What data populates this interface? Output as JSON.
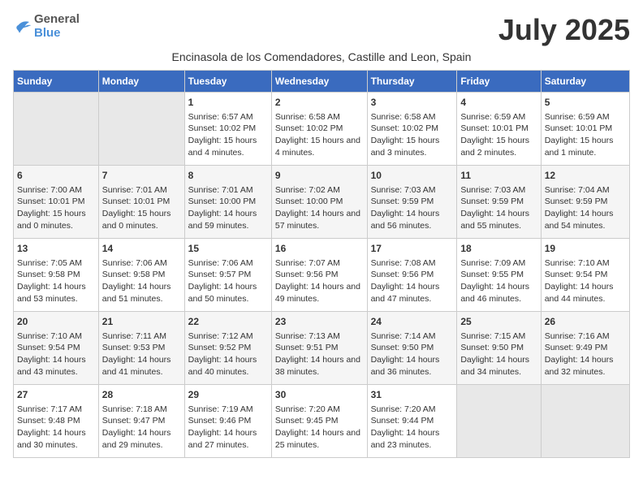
{
  "header": {
    "logo_general": "General",
    "logo_blue": "Blue",
    "month_title": "July 2025"
  },
  "subtitle": "Encinasola de los Comendadores, Castille and Leon, Spain",
  "days_of_week": [
    "Sunday",
    "Monday",
    "Tuesday",
    "Wednesday",
    "Thursday",
    "Friday",
    "Saturday"
  ],
  "weeks": [
    [
      {
        "day": "",
        "content": ""
      },
      {
        "day": "",
        "content": ""
      },
      {
        "day": "1",
        "content": "Sunrise: 6:57 AM\nSunset: 10:02 PM\nDaylight: 15 hours and 4 minutes."
      },
      {
        "day": "2",
        "content": "Sunrise: 6:58 AM\nSunset: 10:02 PM\nDaylight: 15 hours and 4 minutes."
      },
      {
        "day": "3",
        "content": "Sunrise: 6:58 AM\nSunset: 10:02 PM\nDaylight: 15 hours and 3 minutes."
      },
      {
        "day": "4",
        "content": "Sunrise: 6:59 AM\nSunset: 10:01 PM\nDaylight: 15 hours and 2 minutes."
      },
      {
        "day": "5",
        "content": "Sunrise: 6:59 AM\nSunset: 10:01 PM\nDaylight: 15 hours and 1 minute."
      }
    ],
    [
      {
        "day": "6",
        "content": "Sunrise: 7:00 AM\nSunset: 10:01 PM\nDaylight: 15 hours and 0 minutes."
      },
      {
        "day": "7",
        "content": "Sunrise: 7:01 AM\nSunset: 10:01 PM\nDaylight: 15 hours and 0 minutes."
      },
      {
        "day": "8",
        "content": "Sunrise: 7:01 AM\nSunset: 10:00 PM\nDaylight: 14 hours and 59 minutes."
      },
      {
        "day": "9",
        "content": "Sunrise: 7:02 AM\nSunset: 10:00 PM\nDaylight: 14 hours and 57 minutes."
      },
      {
        "day": "10",
        "content": "Sunrise: 7:03 AM\nSunset: 9:59 PM\nDaylight: 14 hours and 56 minutes."
      },
      {
        "day": "11",
        "content": "Sunrise: 7:03 AM\nSunset: 9:59 PM\nDaylight: 14 hours and 55 minutes."
      },
      {
        "day": "12",
        "content": "Sunrise: 7:04 AM\nSunset: 9:59 PM\nDaylight: 14 hours and 54 minutes."
      }
    ],
    [
      {
        "day": "13",
        "content": "Sunrise: 7:05 AM\nSunset: 9:58 PM\nDaylight: 14 hours and 53 minutes."
      },
      {
        "day": "14",
        "content": "Sunrise: 7:06 AM\nSunset: 9:58 PM\nDaylight: 14 hours and 51 minutes."
      },
      {
        "day": "15",
        "content": "Sunrise: 7:06 AM\nSunset: 9:57 PM\nDaylight: 14 hours and 50 minutes."
      },
      {
        "day": "16",
        "content": "Sunrise: 7:07 AM\nSunset: 9:56 PM\nDaylight: 14 hours and 49 minutes."
      },
      {
        "day": "17",
        "content": "Sunrise: 7:08 AM\nSunset: 9:56 PM\nDaylight: 14 hours and 47 minutes."
      },
      {
        "day": "18",
        "content": "Sunrise: 7:09 AM\nSunset: 9:55 PM\nDaylight: 14 hours and 46 minutes."
      },
      {
        "day": "19",
        "content": "Sunrise: 7:10 AM\nSunset: 9:54 PM\nDaylight: 14 hours and 44 minutes."
      }
    ],
    [
      {
        "day": "20",
        "content": "Sunrise: 7:10 AM\nSunset: 9:54 PM\nDaylight: 14 hours and 43 minutes."
      },
      {
        "day": "21",
        "content": "Sunrise: 7:11 AM\nSunset: 9:53 PM\nDaylight: 14 hours and 41 minutes."
      },
      {
        "day": "22",
        "content": "Sunrise: 7:12 AM\nSunset: 9:52 PM\nDaylight: 14 hours and 40 minutes."
      },
      {
        "day": "23",
        "content": "Sunrise: 7:13 AM\nSunset: 9:51 PM\nDaylight: 14 hours and 38 minutes."
      },
      {
        "day": "24",
        "content": "Sunrise: 7:14 AM\nSunset: 9:50 PM\nDaylight: 14 hours and 36 minutes."
      },
      {
        "day": "25",
        "content": "Sunrise: 7:15 AM\nSunset: 9:50 PM\nDaylight: 14 hours and 34 minutes."
      },
      {
        "day": "26",
        "content": "Sunrise: 7:16 AM\nSunset: 9:49 PM\nDaylight: 14 hours and 32 minutes."
      }
    ],
    [
      {
        "day": "27",
        "content": "Sunrise: 7:17 AM\nSunset: 9:48 PM\nDaylight: 14 hours and 30 minutes."
      },
      {
        "day": "28",
        "content": "Sunrise: 7:18 AM\nSunset: 9:47 PM\nDaylight: 14 hours and 29 minutes."
      },
      {
        "day": "29",
        "content": "Sunrise: 7:19 AM\nSunset: 9:46 PM\nDaylight: 14 hours and 27 minutes."
      },
      {
        "day": "30",
        "content": "Sunrise: 7:20 AM\nSunset: 9:45 PM\nDaylight: 14 hours and 25 minutes."
      },
      {
        "day": "31",
        "content": "Sunrise: 7:20 AM\nSunset: 9:44 PM\nDaylight: 14 hours and 23 minutes."
      },
      {
        "day": "",
        "content": ""
      },
      {
        "day": "",
        "content": ""
      }
    ]
  ]
}
